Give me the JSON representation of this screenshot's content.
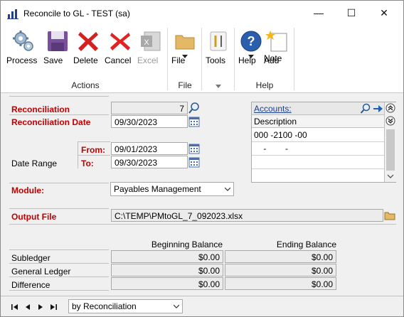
{
  "window": {
    "title": "Reconcile to GL  -  TEST (sa)",
    "minimize_glyph": "—",
    "maximize_glyph": "☐",
    "close_glyph": "✕"
  },
  "ribbon": {
    "actions": {
      "group_label": "Actions",
      "process": "Process",
      "save": "Save",
      "delete": "Delete",
      "cancel": "Cancel",
      "excel": "Excel"
    },
    "file": {
      "group_label": "File",
      "button": "File"
    },
    "tools": {
      "button": "Tools"
    },
    "help": {
      "group_label": "Help",
      "help_button": "Help",
      "add_note_line1": "Add",
      "add_note_line2": "Note"
    }
  },
  "form": {
    "reconciliation_label": "Reconciliation",
    "reconciliation_value": "7",
    "reconciliation_date_label": "Reconciliation Date",
    "reconciliation_date_value": "09/30/2023",
    "date_range_label": "Date Range",
    "from_label": "From:",
    "from_value": "09/01/2023",
    "to_label": "To:",
    "to_value": "09/30/2023",
    "module_label": "Module:",
    "module_value": "Payables Management",
    "output_file_label": "Output File",
    "output_file_value": "C:\\TEMP\\PMtoGL_7_092023.xlsx"
  },
  "accounts": {
    "header_link": "Accounts:",
    "description_label": "Description",
    "rows": [
      "000 -2100 -00",
      "    -        -",
      "",
      ""
    ]
  },
  "balances": {
    "beginning_header": "Beginning Balance",
    "ending_header": "Ending Balance",
    "rows": [
      {
        "label": "Subledger",
        "beginning": "$0.00",
        "ending": "$0.00"
      },
      {
        "label": "General Ledger",
        "beginning": "$0.00",
        "ending": "$0.00"
      },
      {
        "label": "Difference",
        "beginning": "$0.00",
        "ending": "$0.00"
      }
    ]
  },
  "navigation": {
    "sort_value": "by Reconciliation"
  },
  "colors": {
    "required_label": "#c00000",
    "link": "#1a3f8f"
  }
}
